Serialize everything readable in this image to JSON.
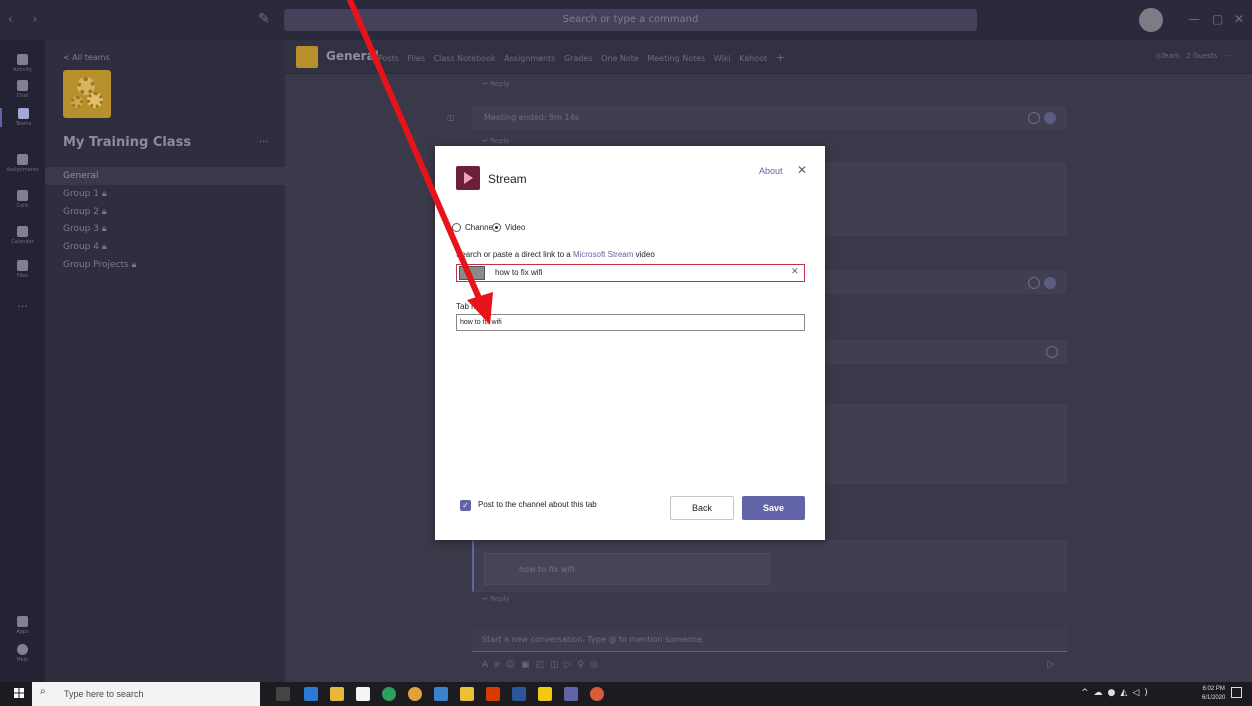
{
  "titlebar": {
    "search_placeholder": "Search or type a command"
  },
  "rail": {
    "items": [
      {
        "label": "Activity",
        "icon": "bell-icon"
      },
      {
        "label": "Chat",
        "icon": "chat-icon"
      },
      {
        "label": "Teams",
        "icon": "teams-icon"
      },
      {
        "label": "Assignments",
        "icon": "assignments-icon"
      },
      {
        "label": "Calls",
        "icon": "phone-icon"
      },
      {
        "label": "Calendar",
        "icon": "calendar-icon"
      },
      {
        "label": "Files",
        "icon": "file-icon"
      }
    ],
    "more": "···",
    "apps_label": "Apps",
    "help_label": "Help"
  },
  "teampanel": {
    "all_teams": "< All teams",
    "team_name": "My Training Class",
    "more": "···",
    "channels": [
      "General",
      "Group 1",
      "Group 2",
      "Group 3",
      "Group 4",
      "Group Projects"
    ]
  },
  "channel": {
    "name": "General",
    "tabs": [
      "Posts",
      "Files",
      "Class Notebook",
      "Assignments",
      "Grades",
      "One Note",
      "Meeting Notes",
      "Wiki",
      "Kahoot",
      "+"
    ],
    "team_btn": "Team",
    "guests": "2 Guests",
    "more": "···"
  },
  "feed": {
    "reply": "Reply",
    "meeting_ended": "Meeting ended: 9m 14s",
    "card_title": "how to fix wifi",
    "new_conversation": "Start a new conversation. Type @ to mention someone."
  },
  "dialog": {
    "title": "Stream",
    "about": "About",
    "radio_channel": "Channel",
    "radio_video": "Video",
    "search_label_pre": "Search or paste a direct link to a ",
    "search_label_link": "Microsoft Stream",
    "search_label_post": " video",
    "video_value": "how to fix wifi",
    "tab_name_label": "Tab name",
    "tab_name_value": "how to fix wifi",
    "post_checkbox": "Post to the channel about this tab",
    "post_checked": true,
    "back": "Back",
    "save": "Save",
    "accent": "#6264a7"
  },
  "taskbar": {
    "search_placeholder": "Type here to search",
    "time": "6:02 PM",
    "date": "6/1/2020"
  },
  "annotation": {
    "arrow_color": "#e8131a"
  }
}
